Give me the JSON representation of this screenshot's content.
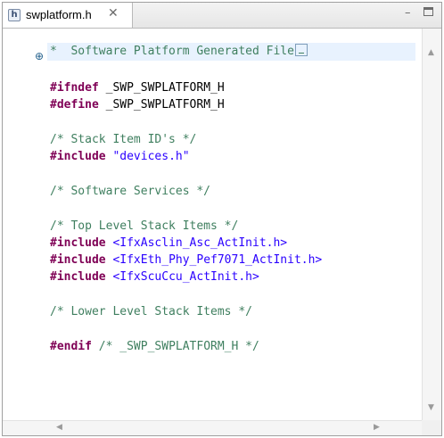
{
  "tab": {
    "icon": "header-file-icon",
    "icon_glyph": "h",
    "title": "swplatform.h",
    "close_glyph": "✕"
  },
  "window_controls": {
    "minimize_glyph": "–",
    "maximize_icon": "maximize-icon"
  },
  "editor": {
    "fold_glyph": "⊕",
    "lines": {
      "l1_comment": "*  Software Platform Generated File",
      "l3_kw": "#ifndef",
      "l3_rest": " _SWP_SWPLATFORM_H",
      "l4_kw": "#define",
      "l4_rest": " _SWP_SWPLATFORM_H",
      "l6_comment": "/* Stack Item ID's */",
      "l7_kw": "#include",
      "l7_str": "\"devices.h\"",
      "l9_comment": "/* Software Services */",
      "l11_comment": "/* Top Level Stack Items */",
      "l12_kw": "#include",
      "l12_inc": "<IfxAsclin_Asc_ActInit.h>",
      "l13_kw": "#include",
      "l13_inc": "<IfxEth_Phy_Pef7071_ActInit.h>",
      "l14_kw": "#include",
      "l14_inc": "<IfxScuCcu_ActInit.h>",
      "l16_comment": "/* Lower Level Stack Items */",
      "l18_kw": "#endif",
      "l18_comment": "/* _SWP_SWPLATFORM_H */"
    }
  },
  "colors": {
    "keyword": "#7f0055",
    "comment": "#3f7f5f",
    "string": "#2a00ff",
    "current_line": "#e8f2fe"
  }
}
